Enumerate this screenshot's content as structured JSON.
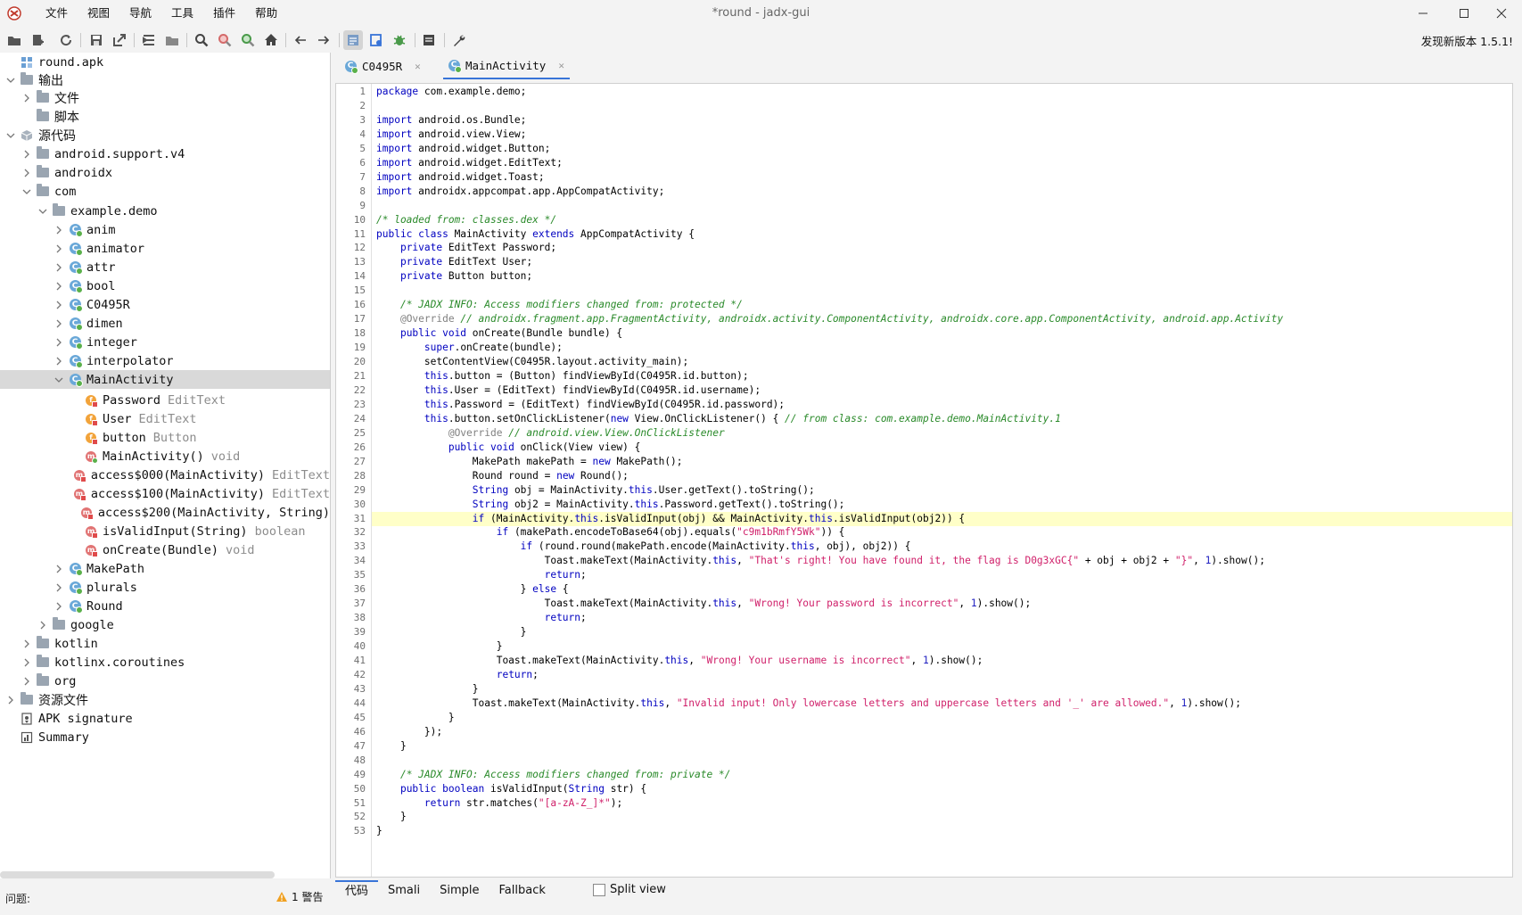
{
  "window": {
    "title": "*round - jadx-gui",
    "menu": [
      "文件",
      "视图",
      "导航",
      "工具",
      "插件",
      "帮助"
    ],
    "update_note": "发现新版本 1.5.1!"
  },
  "toolbar": {
    "buttons": [
      "open-file",
      "add-files",
      "reload",
      "save-all",
      "export",
      "sync-editor",
      "flatten-packages",
      "search",
      "find-usage",
      "goto-class",
      "home",
      "back",
      "forward",
      "deobfuscation",
      "quick-tab",
      "debugger",
      "log-viewer",
      "preferences"
    ]
  },
  "tree": {
    "rows": [
      {
        "label": "round.apk",
        "indent": 0,
        "arrow": "none",
        "icon": "apk-icon"
      },
      {
        "label": "输出",
        "indent": 0,
        "arrow": "down",
        "icon": "folder-icon",
        "cjk": true
      },
      {
        "label": "文件",
        "indent": 1,
        "arrow": "right",
        "icon": "folder-icon",
        "cjk": true
      },
      {
        "label": "脚本",
        "indent": 1,
        "arrow": "none",
        "icon": "folder-icon",
        "cjk": true
      },
      {
        "label": "源代码",
        "indent": 0,
        "arrow": "down",
        "icon": "package-icon",
        "cjk": true
      },
      {
        "label": "android.support.v4",
        "indent": 1,
        "arrow": "right",
        "icon": "folder-icon"
      },
      {
        "label": "androidx",
        "indent": 1,
        "arrow": "right",
        "icon": "folder-icon"
      },
      {
        "label": "com",
        "indent": 1,
        "arrow": "down",
        "icon": "folder-icon"
      },
      {
        "label": "example.demo",
        "indent": 2,
        "arrow": "down",
        "icon": "folder-icon"
      },
      {
        "label": "anim",
        "indent": 3,
        "arrow": "right",
        "icon": "class-icon"
      },
      {
        "label": "animator",
        "indent": 3,
        "arrow": "right",
        "icon": "class-icon"
      },
      {
        "label": "attr",
        "indent": 3,
        "arrow": "right",
        "icon": "class-icon"
      },
      {
        "label": "bool",
        "indent": 3,
        "arrow": "right",
        "icon": "class-icon"
      },
      {
        "label": "C0495R",
        "indent": 3,
        "arrow": "right",
        "icon": "class-icon"
      },
      {
        "label": "dimen",
        "indent": 3,
        "arrow": "right",
        "icon": "class-icon"
      },
      {
        "label": "integer",
        "indent": 3,
        "arrow": "right",
        "icon": "class-icon"
      },
      {
        "label": "interpolator",
        "indent": 3,
        "arrow": "right",
        "icon": "class-icon"
      },
      {
        "label": "MainActivity",
        "indent": 3,
        "arrow": "down",
        "icon": "class-icon",
        "selected": true
      },
      {
        "label": "Password",
        "type": "EditText",
        "indent": 4,
        "arrow": "none",
        "icon": "field-icon"
      },
      {
        "label": "User",
        "type": "EditText",
        "indent": 4,
        "arrow": "none",
        "icon": "field-icon"
      },
      {
        "label": "button",
        "type": "Button",
        "indent": 4,
        "arrow": "none",
        "icon": "field-icon"
      },
      {
        "label": "MainActivity()",
        "type": "void",
        "indent": 4,
        "arrow": "none",
        "icon": "method-public-icon"
      },
      {
        "label": "access$000(MainActivity)",
        "type": "EditText",
        "indent": 4,
        "arrow": "none",
        "icon": "method-icon"
      },
      {
        "label": "access$100(MainActivity)",
        "type": "EditText",
        "indent": 4,
        "arrow": "none",
        "icon": "method-icon"
      },
      {
        "label": "access$200(MainActivity, String)",
        "type": "",
        "indent": 4,
        "arrow": "none",
        "icon": "method-icon"
      },
      {
        "label": "isValidInput(String)",
        "type": "boolean",
        "indent": 4,
        "arrow": "none",
        "icon": "method-icon"
      },
      {
        "label": "onCreate(Bundle)",
        "type": "void",
        "indent": 4,
        "arrow": "none",
        "icon": "method-icon"
      },
      {
        "label": "MakePath",
        "indent": 3,
        "arrow": "right",
        "icon": "class-icon"
      },
      {
        "label": "plurals",
        "indent": 3,
        "arrow": "right",
        "icon": "class-icon"
      },
      {
        "label": "Round",
        "indent": 3,
        "arrow": "right",
        "icon": "class-icon"
      },
      {
        "label": "google",
        "indent": 2,
        "arrow": "right",
        "icon": "folder-icon"
      },
      {
        "label": "kotlin",
        "indent": 1,
        "arrow": "right",
        "icon": "folder-icon"
      },
      {
        "label": "kotlinx.coroutines",
        "indent": 1,
        "arrow": "right",
        "icon": "folder-icon"
      },
      {
        "label": "org",
        "indent": 1,
        "arrow": "right",
        "icon": "folder-icon"
      },
      {
        "label": "资源文件",
        "indent": 0,
        "arrow": "right",
        "icon": "folder-icon",
        "cjk": true
      },
      {
        "label": "APK signature",
        "indent": 0,
        "arrow": "none",
        "icon": "certificate-icon"
      },
      {
        "label": "Summary",
        "indent": 0,
        "arrow": "none",
        "icon": "summary-icon"
      }
    ]
  },
  "tabs": [
    {
      "label": "C0495R",
      "active": false
    },
    {
      "label": "MainActivity",
      "active": true
    }
  ],
  "editor": {
    "highlight_line": 31,
    "lines": [
      [
        [
          "kw",
          "package"
        ],
        [
          "t",
          " com.example.demo;"
        ]
      ],
      [],
      [
        [
          "kw",
          "import"
        ],
        [
          "t",
          " android.os.Bundle;"
        ]
      ],
      [
        [
          "kw",
          "import"
        ],
        [
          "t",
          " android.view.View;"
        ]
      ],
      [
        [
          "kw",
          "import"
        ],
        [
          "t",
          " android.widget.Button;"
        ]
      ],
      [
        [
          "kw",
          "import"
        ],
        [
          "t",
          " android.widget.EditText;"
        ]
      ],
      [
        [
          "kw",
          "import"
        ],
        [
          "t",
          " android.widget.Toast;"
        ]
      ],
      [
        [
          "kw",
          "import"
        ],
        [
          "t",
          " androidx.appcompat.app.AppCompatActivity;"
        ]
      ],
      [],
      [
        [
          "cmt",
          "/* loaded from: classes.dex */"
        ]
      ],
      [
        [
          "kw",
          "public class"
        ],
        [
          "t",
          " MainActivity "
        ],
        [
          "kw",
          "extends"
        ],
        [
          "t",
          " AppCompatActivity {"
        ]
      ],
      [
        [
          "t",
          "    "
        ],
        [
          "kw",
          "private"
        ],
        [
          "t",
          " EditText Password;"
        ]
      ],
      [
        [
          "t",
          "    "
        ],
        [
          "kw",
          "private"
        ],
        [
          "t",
          " EditText User;"
        ]
      ],
      [
        [
          "t",
          "    "
        ],
        [
          "kw",
          "private"
        ],
        [
          "t",
          " Button button;"
        ]
      ],
      [],
      [
        [
          "t",
          "    "
        ],
        [
          "cmt",
          "/* JADX INFO: Access modifiers changed from: protected */"
        ]
      ],
      [
        [
          "t",
          "    "
        ],
        [
          "ann",
          "@Override"
        ],
        [
          "t",
          " "
        ],
        [
          "cmt",
          "// androidx.fragment.app.FragmentActivity, androidx.activity.ComponentActivity, androidx.core.app.ComponentActivity, android.app.Activity"
        ]
      ],
      [
        [
          "t",
          "    "
        ],
        [
          "kw",
          "public void"
        ],
        [
          "t",
          " onCreate(Bundle bundle) {"
        ]
      ],
      [
        [
          "t",
          "        "
        ],
        [
          "kw",
          "super"
        ],
        [
          "t",
          ".onCreate(bundle);"
        ]
      ],
      [
        [
          "t",
          "        setContentView(C0495R.layout.activity_main);"
        ]
      ],
      [
        [
          "t",
          "        "
        ],
        [
          "kw",
          "this"
        ],
        [
          "t",
          ".button = (Button) findViewById(C0495R.id.button);"
        ]
      ],
      [
        [
          "t",
          "        "
        ],
        [
          "kw",
          "this"
        ],
        [
          "t",
          ".User = (EditText) findViewById(C0495R.id.username);"
        ]
      ],
      [
        [
          "t",
          "        "
        ],
        [
          "kw",
          "this"
        ],
        [
          "t",
          ".Password = (EditText) findViewById(C0495R.id.password);"
        ]
      ],
      [
        [
          "t",
          "        "
        ],
        [
          "kw",
          "this"
        ],
        [
          "t",
          ".button.setOnClickListener("
        ],
        [
          "kw",
          "new"
        ],
        [
          "t",
          " View.OnClickListener() { "
        ],
        [
          "cmt",
          "// from class: com.example.demo.MainActivity.1"
        ]
      ],
      [
        [
          "t",
          "            "
        ],
        [
          "ann",
          "@Override"
        ],
        [
          "t",
          " "
        ],
        [
          "cmt",
          "// android.view.View.OnClickListener"
        ]
      ],
      [
        [
          "t",
          "            "
        ],
        [
          "kw",
          "public void"
        ],
        [
          "t",
          " onClick(View view) {"
        ]
      ],
      [
        [
          "t",
          "                MakePath makePath = "
        ],
        [
          "kw",
          "new"
        ],
        [
          "t",
          " MakePath();"
        ]
      ],
      [
        [
          "t",
          "                Round round = "
        ],
        [
          "kw",
          "new"
        ],
        [
          "t",
          " Round();"
        ]
      ],
      [
        [
          "t",
          "                "
        ],
        [
          "kw",
          "String"
        ],
        [
          "t",
          " obj = MainActivity."
        ],
        [
          "kw",
          "this"
        ],
        [
          "t",
          ".User.getText().toString();"
        ]
      ],
      [
        [
          "t",
          "                "
        ],
        [
          "kw",
          "String"
        ],
        [
          "t",
          " obj2 = MainActivity."
        ],
        [
          "kw",
          "this"
        ],
        [
          "t",
          ".Password.getText().toString();"
        ]
      ],
      [
        [
          "t",
          "                "
        ],
        [
          "kw",
          "if"
        ],
        [
          "t",
          " (MainActivity."
        ],
        [
          "kw",
          "this"
        ],
        [
          "t",
          ".isValidInput(obj) && MainActivity."
        ],
        [
          "kw",
          "this"
        ],
        [
          "t",
          ".isValidInput(obj2)) {"
        ]
      ],
      [
        [
          "t",
          "                    "
        ],
        [
          "kw",
          "if"
        ],
        [
          "t",
          " (makePath.encodeToBase64(obj).equals("
        ],
        [
          "str",
          "\"c9m1bRmfY5Wk\""
        ],
        [
          "t",
          ")) {"
        ]
      ],
      [
        [
          "t",
          "                        "
        ],
        [
          "kw",
          "if"
        ],
        [
          "t",
          " (round.round(makePath.encode(MainActivity."
        ],
        [
          "kw",
          "this"
        ],
        [
          "t",
          ", obj), obj2)) {"
        ]
      ],
      [
        [
          "t",
          "                            Toast.makeText(MainActivity."
        ],
        [
          "kw",
          "this"
        ],
        [
          "t",
          ", "
        ],
        [
          "str",
          "\"That's right! You have found it, the flag is D0g3xGC{\""
        ],
        [
          "t",
          " + obj + obj2 + "
        ],
        [
          "str",
          "\"}\""
        ],
        [
          "t",
          ", "
        ],
        [
          "num",
          "1"
        ],
        [
          "t",
          ").show();"
        ]
      ],
      [
        [
          "t",
          "                            "
        ],
        [
          "kw",
          "return"
        ],
        [
          "t",
          ";"
        ]
      ],
      [
        [
          "t",
          "                        } "
        ],
        [
          "kw",
          "else"
        ],
        [
          "t",
          " {"
        ]
      ],
      [
        [
          "t",
          "                            Toast.makeText(MainActivity."
        ],
        [
          "kw",
          "this"
        ],
        [
          "t",
          ", "
        ],
        [
          "str",
          "\"Wrong! Your password is incorrect\""
        ],
        [
          "t",
          ", "
        ],
        [
          "num",
          "1"
        ],
        [
          "t",
          ").show();"
        ]
      ],
      [
        [
          "t",
          "                            "
        ],
        [
          "kw",
          "return"
        ],
        [
          "t",
          ";"
        ]
      ],
      [
        [
          "t",
          "                        }"
        ]
      ],
      [
        [
          "t",
          "                    }"
        ]
      ],
      [
        [
          "t",
          "                    Toast.makeText(MainActivity."
        ],
        [
          "kw",
          "this"
        ],
        [
          "t",
          ", "
        ],
        [
          "str",
          "\"Wrong! Your username is incorrect\""
        ],
        [
          "t",
          ", "
        ],
        [
          "num",
          "1"
        ],
        [
          "t",
          ").show();"
        ]
      ],
      [
        [
          "t",
          "                    "
        ],
        [
          "kw",
          "return"
        ],
        [
          "t",
          ";"
        ]
      ],
      [
        [
          "t",
          "                }"
        ]
      ],
      [
        [
          "t",
          "                Toast.makeText(MainActivity."
        ],
        [
          "kw",
          "this"
        ],
        [
          "t",
          ", "
        ],
        [
          "str",
          "\"Invalid input! Only lowercase letters and uppercase letters and '_' are allowed.\""
        ],
        [
          "t",
          ", "
        ],
        [
          "num",
          "1"
        ],
        [
          "t",
          ").show();"
        ]
      ],
      [
        [
          "t",
          "            }"
        ]
      ],
      [
        [
          "t",
          "        });"
        ]
      ],
      [
        [
          "t",
          "    }"
        ]
      ],
      [],
      [
        [
          "t",
          "    "
        ],
        [
          "cmt",
          "/* JADX INFO: Access modifiers changed from: private */"
        ]
      ],
      [
        [
          "t",
          "    "
        ],
        [
          "kw",
          "public boolean"
        ],
        [
          "t",
          " isValidInput("
        ],
        [
          "kw",
          "String"
        ],
        [
          "t",
          " str) {"
        ]
      ],
      [
        [
          "t",
          "        "
        ],
        [
          "kw",
          "return"
        ],
        [
          "t",
          " str.matches("
        ],
        [
          "str",
          "\"[a-zA-Z_]*\""
        ],
        [
          "t",
          ");"
        ]
      ],
      [
        [
          "t",
          "    }"
        ]
      ],
      [
        [
          "t",
          "}"
        ]
      ]
    ]
  },
  "bottom_tabs": [
    {
      "label": "代码",
      "active": true
    },
    {
      "label": "Smali",
      "active": false
    },
    {
      "label": "Simple",
      "active": false
    },
    {
      "label": "Fallback",
      "active": false
    }
  ],
  "split_view_label": "Split view",
  "status": {
    "problems_label": "问题:",
    "warning_count": "1 警告"
  },
  "colors": {
    "accent": "#3874d8",
    "highlight": "#ffffc8",
    "keyword": "#0000c0",
    "string": "#d0206a",
    "comment": "#2a8a2a"
  }
}
